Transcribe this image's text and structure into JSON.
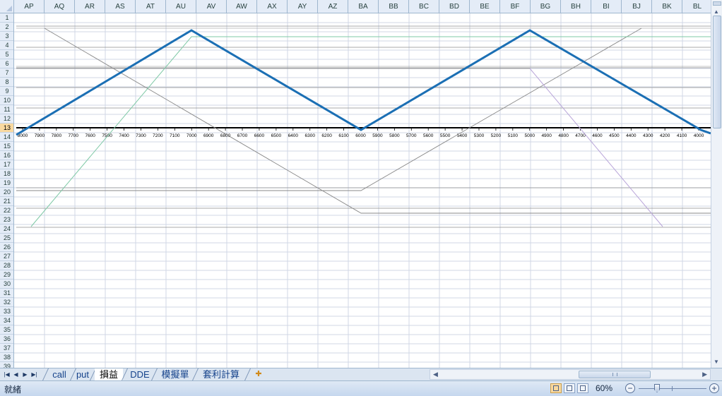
{
  "columns": [
    "AP",
    "AQ",
    "AR",
    "AS",
    "AT",
    "AU",
    "AV",
    "AW",
    "AX",
    "AY",
    "AZ",
    "BA",
    "BB",
    "BC",
    "BD",
    "BE",
    "BF",
    "BG",
    "BH",
    "BI",
    "BJ",
    "BK",
    "BL"
  ],
  "rows": [
    "1",
    "2",
    "3",
    "4",
    "5",
    "6",
    "7",
    "8",
    "9",
    "10",
    "11",
    "12",
    "13",
    "14",
    "15",
    "16",
    "17",
    "18",
    "19",
    "20",
    "21",
    "22",
    "23",
    "24",
    "25",
    "26",
    "27",
    "28",
    "29",
    "30",
    "31",
    "32",
    "33",
    "34",
    "35",
    "36",
    "37",
    "38",
    "39"
  ],
  "active_row": "13",
  "chart": {
    "x_tick_labels": [
      "8000",
      "7900",
      "7800",
      "7700",
      "7600",
      "7500",
      "7400",
      "7300",
      "7200",
      "7100",
      "7000",
      "6900",
      "6800",
      "6700",
      "6600",
      "6500",
      "6400",
      "6300",
      "6200",
      "6100",
      "6000",
      "5900",
      "5800",
      "5700",
      "5600",
      "5500",
      "5400",
      "5300",
      "5200",
      "5100",
      "5000",
      "4900",
      "4800",
      "4700",
      "4600",
      "4500",
      "4400",
      "4300",
      "4200",
      "4100",
      "4000"
    ],
    "colors": {
      "main_series": "#1b6fb4",
      "green_series": "#7fc9a6",
      "gray_series": "#8a8a8a",
      "purple_series": "#b9a5d9",
      "axis": "#000000",
      "gridline": "#8c8c8c"
    }
  },
  "sheet_tabs": {
    "nav_icons": [
      "first-sheet-icon",
      "prev-sheet-icon",
      "next-sheet-icon",
      "last-sheet-icon"
    ],
    "tabs": [
      "call",
      "put",
      "損益",
      "DDE",
      "模擬單",
      "套利計算"
    ],
    "active_tab": "損益"
  },
  "status_bar": {
    "status": "就緒",
    "zoom": "60%",
    "zoom_level": 60,
    "zoom_out": "−",
    "zoom_in": "+"
  }
}
